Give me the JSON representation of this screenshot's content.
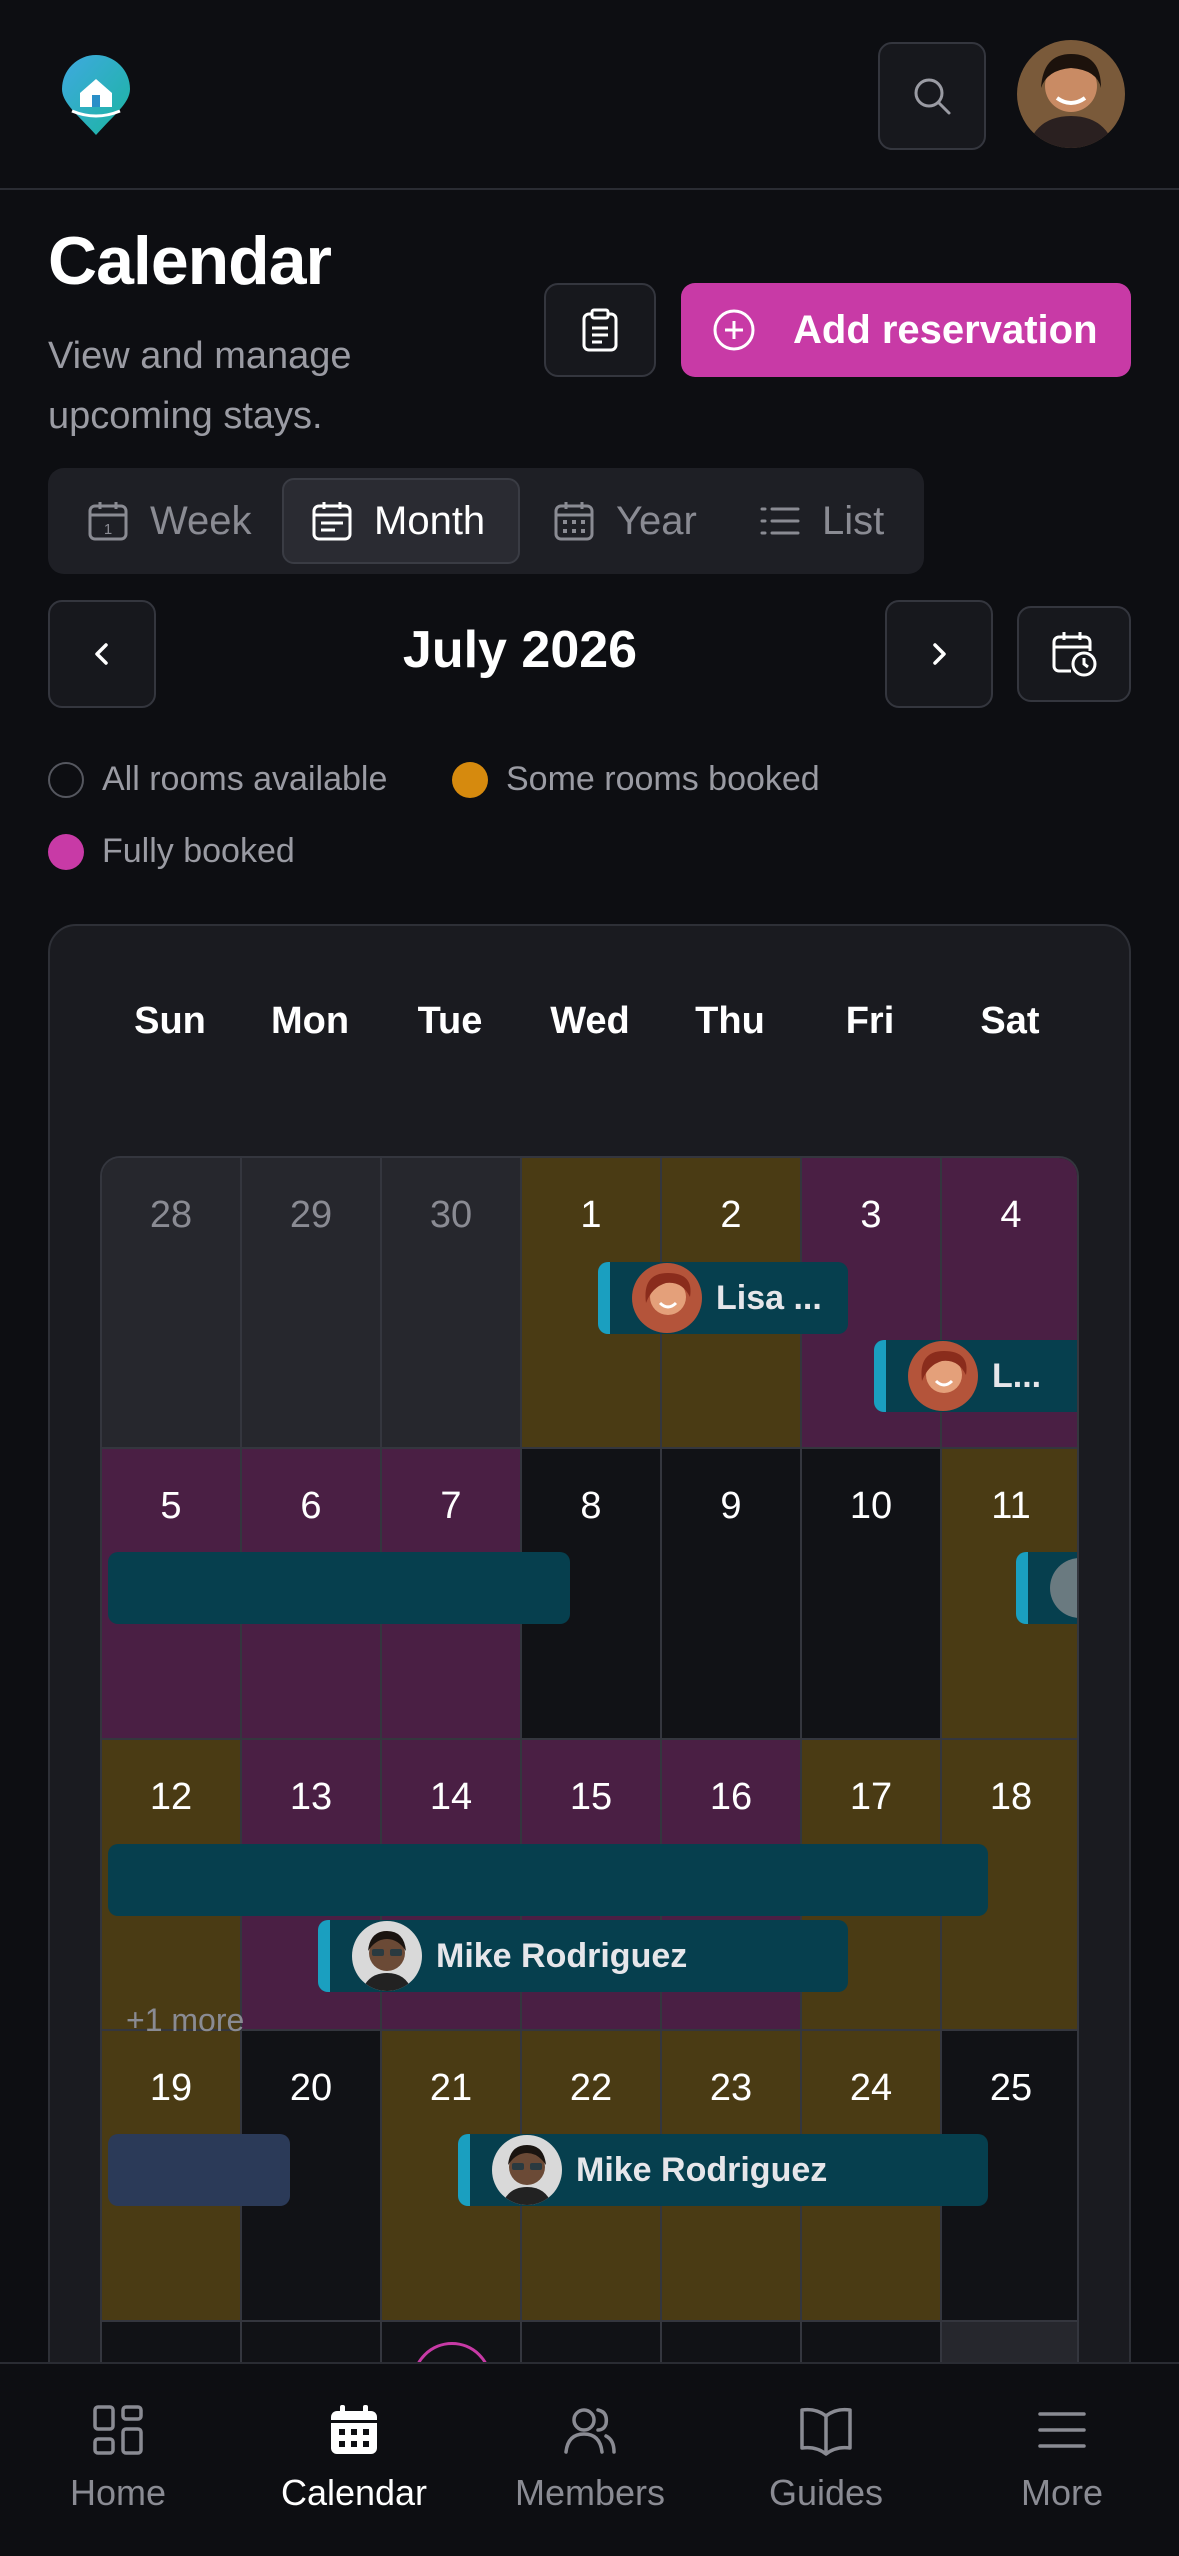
{
  "header": {
    "logo": "beach-house-logo",
    "search_icon": "search-icon",
    "avatar": "user-avatar"
  },
  "page": {
    "title": "Calendar",
    "subtitle": "View and manage upcoming stays.",
    "add_button_label": "Add reservation"
  },
  "view_tabs": [
    {
      "label": "Week",
      "icon": "calendar-day-icon",
      "active": false
    },
    {
      "label": "Month",
      "icon": "calendar-month-icon",
      "active": true
    },
    {
      "label": "Year",
      "icon": "calendar-year-icon",
      "active": false
    },
    {
      "label": "List",
      "icon": "list-icon",
      "active": false
    }
  ],
  "month_nav": {
    "label": "July 2026"
  },
  "legend": [
    {
      "label": "All rooms available",
      "color": "transparent"
    },
    {
      "label": "Some rooms booked",
      "color": "#d68a0e"
    },
    {
      "label": "Fully booked",
      "color": "#c83aa6"
    }
  ],
  "calendar": {
    "weekdays": [
      "Sun",
      "Mon",
      "Tue",
      "Wed",
      "Thu",
      "Fri",
      "Sat"
    ],
    "weeks": [
      [
        "28",
        "29",
        "30",
        "1",
        "2",
        "3",
        "4"
      ],
      [
        "5",
        "6",
        "7",
        "8",
        "9",
        "10",
        "11"
      ],
      [
        "12",
        "13",
        "14",
        "15",
        "16",
        "17",
        "18"
      ],
      [
        "19",
        "20",
        "21",
        "22",
        "23",
        "24",
        "25"
      ]
    ],
    "reservations": [
      {
        "label": "Lisa ..."
      },
      {
        "label": "L..."
      },
      {
        "label": "Mike Rodriguez"
      },
      {
        "label": "Mike Rodriguez"
      }
    ],
    "more_label": "+1 more"
  },
  "colors": {
    "some": "#4a3b14",
    "full": "#4a1f44",
    "outside": "#26272d",
    "free": "#111216",
    "bar": "#063f4e",
    "accent": "#1a9fc0",
    "brand": "#c83aa6"
  },
  "bottom_nav": [
    {
      "label": "Home",
      "icon": "grid-icon",
      "active": false
    },
    {
      "label": "Calendar",
      "icon": "calendar-icon",
      "active": true
    },
    {
      "label": "Members",
      "icon": "users-icon",
      "active": false
    },
    {
      "label": "Guides",
      "icon": "book-icon",
      "active": false
    },
    {
      "label": "More",
      "icon": "menu-icon",
      "active": false
    }
  ]
}
